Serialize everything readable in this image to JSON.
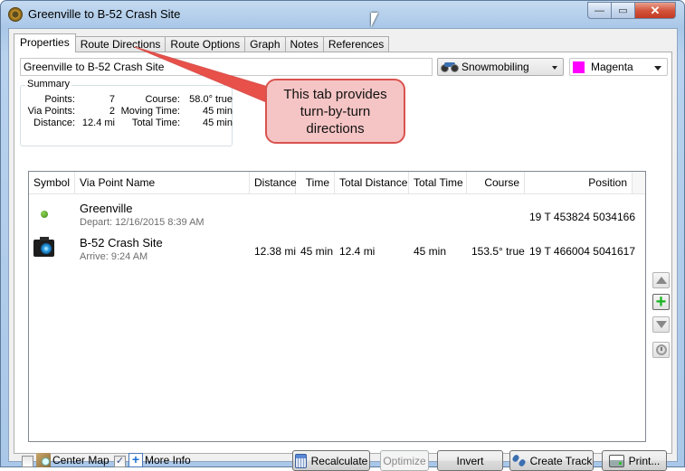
{
  "window": {
    "title": "Greenville to B-52 Crash Site",
    "controls": {
      "minimize": "—",
      "maximize": "▭",
      "close": "✕"
    }
  },
  "tabs": [
    {
      "label": "Properties",
      "active": true
    },
    {
      "label": "Route Directions",
      "active": false
    },
    {
      "label": "Route Options",
      "active": false
    },
    {
      "label": "Graph",
      "active": false
    },
    {
      "label": "Notes",
      "active": false
    },
    {
      "label": "References",
      "active": false
    }
  ],
  "properties": {
    "route_name": "Greenville to B-52 Crash Site",
    "activity": {
      "selected": "Snowmobiling",
      "icon": "motorcycle-icon"
    },
    "color": {
      "selected": "Magenta",
      "swatch": "#ff00ff"
    }
  },
  "summary": {
    "legend": "Summary",
    "points_label": "Points:",
    "points_value": "7",
    "via_points_label": "Via Points:",
    "via_points_value": "2",
    "distance_label": "Distance:",
    "distance_value": "12.4 mi",
    "course_label": "Course:",
    "course_value": "58.0° true",
    "moving_time_label": "Moving Time:",
    "moving_time_value": "45 min",
    "total_time_label": "Total Time:",
    "total_time_value": "45 min"
  },
  "callout": {
    "line1": "This tab provides",
    "line2": "turn-by-turn",
    "line3": "directions",
    "fill": "#f5c4c4",
    "border": "#d9534f"
  },
  "grid": {
    "columns": [
      "Symbol",
      "Via Point Name",
      "Distance",
      "Time",
      "Total Distance",
      "Total Time",
      "Course",
      "Position"
    ],
    "rows": [
      {
        "symbol": "green-dot-icon",
        "name": "Greenville",
        "sub": "Depart: 12/16/2015 8:39 AM",
        "distance": "",
        "time": "",
        "total_distance": "",
        "total_time": "",
        "course": "",
        "position": "19 T 453824 5034166"
      },
      {
        "symbol": "camera-icon",
        "name": "B-52 Crash Site",
        "sub": "Arrive: 9:24 AM",
        "distance": "12.38 mi",
        "time": "45 min",
        "total_distance": "12.4 mi",
        "total_time": "45 min",
        "course": "153.5° true",
        "position": "19 T 466004 5041617"
      }
    ]
  },
  "side_buttons": {
    "move_up": "move-up",
    "add": "+",
    "move_down": "move-down",
    "time": "clock"
  },
  "bottom": {
    "center_map": {
      "label": "Center Map",
      "checked": false
    },
    "more_info": {
      "label": "More Info",
      "checked": true
    },
    "check_mark": "✓",
    "buttons": {
      "recalculate": "Recalculate",
      "optimize": "Optimize",
      "invert": "Invert",
      "create_track": "Create Track",
      "print": "Print..."
    }
  }
}
